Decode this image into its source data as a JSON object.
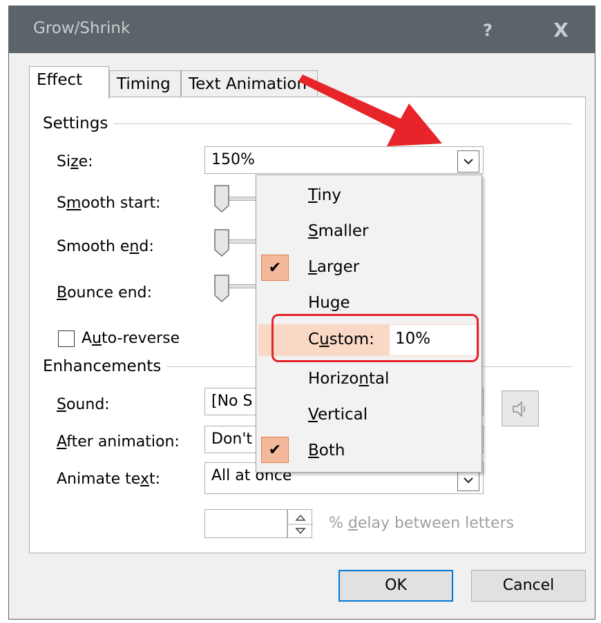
{
  "window": {
    "title": "Grow/Shrink",
    "help_label": "?",
    "close_label": "X"
  },
  "tabs": [
    {
      "label": "Effect",
      "active": true
    },
    {
      "label": "Timing",
      "active": false
    },
    {
      "label": "Text Animation",
      "active": false
    }
  ],
  "settings": {
    "group_label": "Settings",
    "size_label_pre": "Si",
    "size_label_u": "z",
    "size_label_post": "e:",
    "size_value": "150%",
    "smooth_start_pre": "S",
    "smooth_start_u": "m",
    "smooth_start_post": "ooth start:",
    "smooth_end_pre": "Smooth e",
    "smooth_end_u": "n",
    "smooth_end_post": "d:",
    "bounce_end_u": "B",
    "bounce_end_post": "ounce end:",
    "auto_reverse_pre": "A",
    "auto_reverse_u": "u",
    "auto_reverse_post": "to-reverse"
  },
  "enhancements": {
    "group_label": "Enhancements",
    "sound_u": "S",
    "sound_post": "ound:",
    "sound_value": "[No S",
    "after_u": "A",
    "after_post": "fter animation:",
    "after_value": "Don't",
    "animate_text_pre": "Animate te",
    "animate_text_u": "x",
    "animate_text_post": "t:",
    "animate_text_value": "All at once",
    "delay_pre": "% ",
    "delay_u": "d",
    "delay_post": "elay between letters"
  },
  "size_menu": {
    "items": [
      {
        "u": "T",
        "rest": "iny",
        "checked": false
      },
      {
        "u": "S",
        "rest": "maller",
        "checked": false
      },
      {
        "u": "L",
        "rest": "arger",
        "checked": true
      },
      {
        "pre": "Hu",
        "u": "g",
        "rest": "e",
        "checked": false
      },
      {
        "pre": "Horizo",
        "u": "n",
        "rest": "tal",
        "checked": false
      },
      {
        "u": "V",
        "rest": "ertical",
        "checked": false
      },
      {
        "u": "B",
        "rest": "oth",
        "checked": true
      }
    ],
    "custom_pre": "C",
    "custom_u": "u",
    "custom_post": "stom:",
    "custom_value": "10%",
    "check_glyph": "✔"
  },
  "buttons": {
    "ok": "OK",
    "cancel": "Cancel"
  },
  "colors": {
    "titlebar": "#5b6468",
    "check_fill": "#f4b99a",
    "highlight_red": "#e4222a",
    "arrow_red": "#e8242b"
  }
}
